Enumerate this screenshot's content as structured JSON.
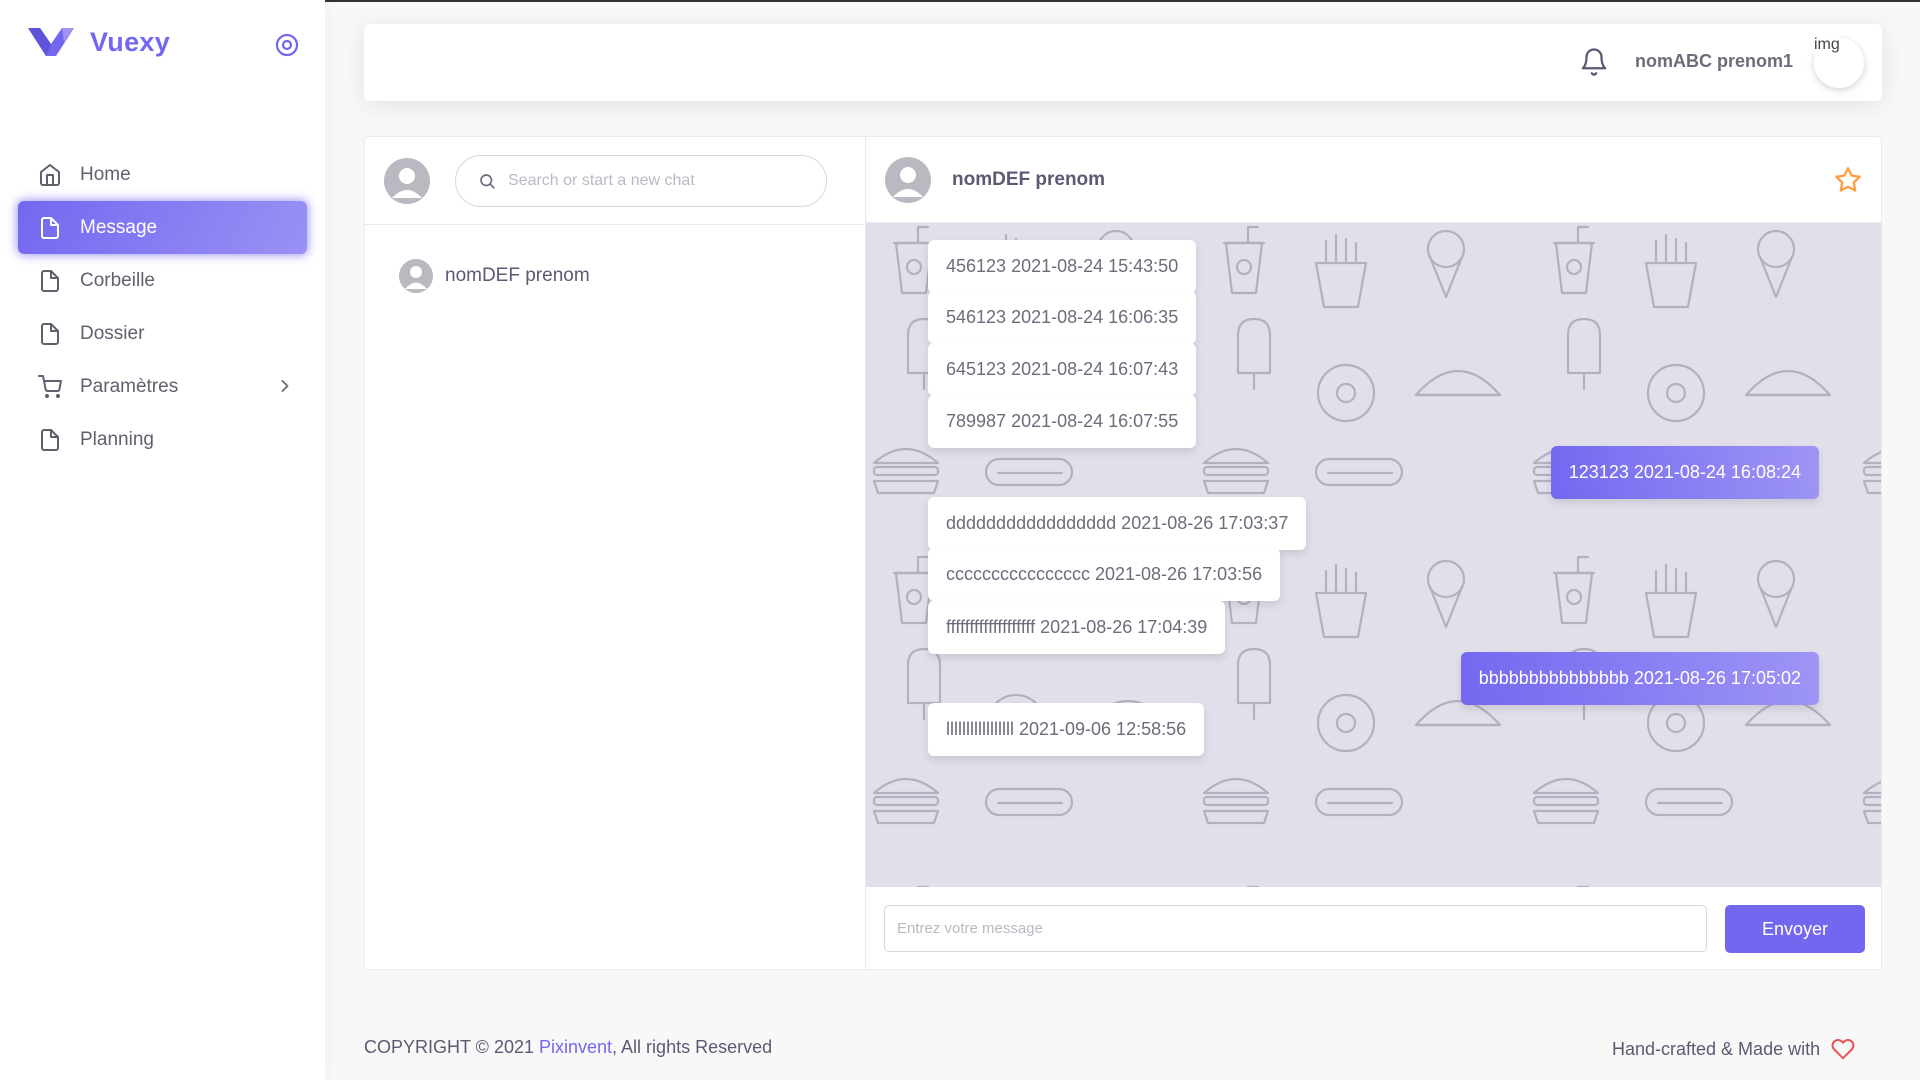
{
  "app": {
    "name": "Vuexy",
    "accent": "#7367f0"
  },
  "sidebar": {
    "items": [
      {
        "label": "Home",
        "icon": "home-icon"
      },
      {
        "label": "Message",
        "icon": "file-icon",
        "active": true
      },
      {
        "label": "Corbeille",
        "icon": "file-icon"
      },
      {
        "label": "Dossier",
        "icon": "file-icon"
      },
      {
        "label": "Paramètres",
        "icon": "shopping-cart-icon",
        "has_submenu": true
      },
      {
        "label": "Planning",
        "icon": "file-icon"
      }
    ]
  },
  "navbar": {
    "user_name": "nomABC prenom1",
    "avatar_alt": "img"
  },
  "contacts": {
    "search_placeholder": "Search or start a new chat",
    "list": [
      {
        "name": "nomDEF prenom"
      }
    ]
  },
  "chat": {
    "title": "nomDEF prenom",
    "messages": [
      {
        "side": "in",
        "text": "456123 2021-08-24 15:43:50"
      },
      {
        "side": "in",
        "text": "546123 2021-08-24 16:06:35"
      },
      {
        "side": "in",
        "text": "645123 2021-08-24 16:07:43"
      },
      {
        "side": "in",
        "text": "789987 2021-08-24 16:07:55"
      },
      {
        "side": "out",
        "text": "123123 2021-08-24 16:08:24"
      },
      {
        "side": "in",
        "text": "ddddddddddddddddd 2021-08-26 17:03:37"
      },
      {
        "side": "in",
        "text": "cccccccccccccccc 2021-08-26 17:03:56"
      },
      {
        "side": "in",
        "text": "fffffffffffffffffff 2021-08-26 17:04:39"
      },
      {
        "side": "out",
        "text": "bbbbbbbbbbbbbbb 2021-08-26 17:05:02"
      },
      {
        "side": "in",
        "text": "lllllllllllllllll 2021-09-06 12:58:56"
      }
    ],
    "input_placeholder": "Entrez votre message",
    "send_label": "Envoyer"
  },
  "footer": {
    "copyright_prefix": "COPYRIGHT © 2021 ",
    "brand_link": "Pixinvent",
    "copyright_suffix": ", All rights Reserved",
    "made_with": "Hand-crafted & Made with"
  }
}
